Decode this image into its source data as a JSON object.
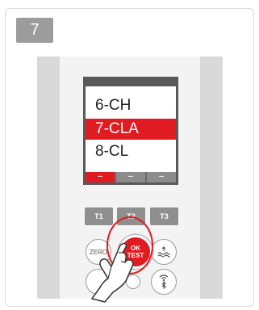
{
  "step": {
    "number": "7"
  },
  "screen": {
    "menu": [
      {
        "label": "6-CH",
        "selected": false
      },
      {
        "label": "7-CLA",
        "selected": true
      },
      {
        "label": "8-CL",
        "selected": false
      }
    ],
    "tabs": [
      "--",
      "--",
      "--"
    ]
  },
  "keys": {
    "t1": "T1",
    "t2": "T2",
    "t3": "T3",
    "zero": "ZERO",
    "ok_line1": "OK",
    "ok_line2": "TEST"
  },
  "icons": {
    "wave": "water-level-icon",
    "wireless": "wireless-icon",
    "bluetooth": "bluetooth-icon",
    "hand": "pointing-hand-icon"
  },
  "colors": {
    "accent": "#e11b22",
    "badge": "#9c9c9c",
    "screen_frame": "#595959"
  }
}
